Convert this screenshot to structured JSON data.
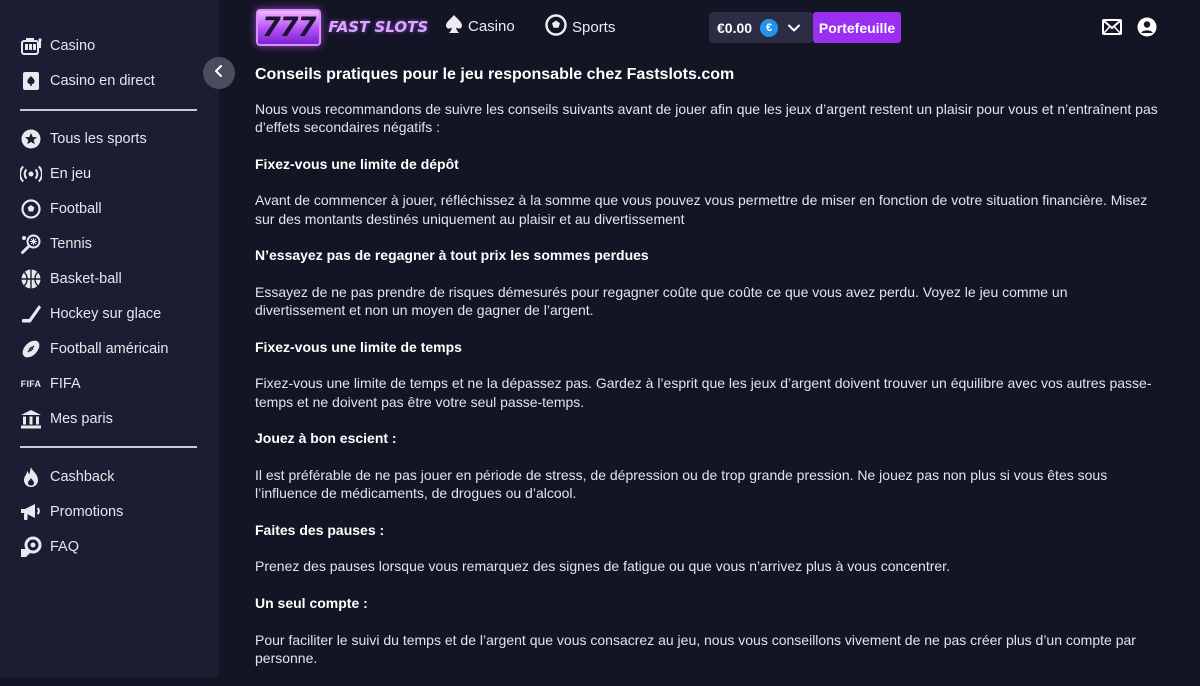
{
  "sidebar": {
    "groups": [
      {
        "items": [
          {
            "label": "Casino",
            "icon": "slot-machine-icon"
          },
          {
            "label": "Casino en direct",
            "icon": "playing-card-icon"
          }
        ]
      },
      {
        "items": [
          {
            "label": "Tous les sports",
            "icon": "star-icon"
          },
          {
            "label": "En jeu",
            "icon": "live-broadcast-icon"
          },
          {
            "label": "Football",
            "icon": "soccer-ball-icon"
          },
          {
            "label": "Tennis",
            "icon": "tennis-racket-icon"
          },
          {
            "label": "Basket-ball",
            "icon": "basketball-icon"
          },
          {
            "label": "Hockey sur glace",
            "icon": "hockey-stick-icon"
          },
          {
            "label": "Football américain",
            "icon": "american-football-icon"
          },
          {
            "label": "FIFA",
            "icon": "fifa-icon",
            "icon_text": "FIFA"
          },
          {
            "label": "Mes paris",
            "icon": "bet-slip-icon"
          }
        ]
      },
      {
        "items": [
          {
            "label": "Cashback",
            "icon": "flame-icon"
          },
          {
            "label": "Promotions",
            "icon": "megaphone-icon"
          },
          {
            "label": "FAQ",
            "icon": "lifebuoy-icon"
          }
        ]
      }
    ]
  },
  "header": {
    "logo_sevens": "777",
    "logo_text": "FAST SLOTS",
    "nav": [
      {
        "label": "Casino",
        "icon": "spade-icon"
      },
      {
        "label": "Sports",
        "icon": "soccer-ball-icon"
      }
    ],
    "balance": "€0.00",
    "currency_symbol": "€",
    "wallet_button": "Portefeuille",
    "icons": [
      "mail-icon",
      "user-icon"
    ]
  },
  "article": {
    "title": "Conseils pratiques pour le jeu responsable chez Fastslots.com",
    "blocks": [
      {
        "type": "p",
        "text": "Nous vous recommandons de suivre les conseils suivants avant de jouer afin que les jeux d’argent restent un plaisir pour vous et n’entraînent pas d’effets secondaires négatifs :"
      },
      {
        "type": "h",
        "text": "Fixez-vous une limite de dépôt"
      },
      {
        "type": "p",
        "text": "Avant de commencer à jouer, réfléchissez à la somme que vous pouvez vous permettre de miser en fonction de votre situation financière. Misez sur des montants destinés uniquement au plaisir et au divertissement"
      },
      {
        "type": "h",
        "text": "N’essayez pas de regagner à tout prix les sommes perdues"
      },
      {
        "type": "p",
        "text": "Essayez de ne pas prendre de risques démesurés pour regagner coûte que coûte ce que vous avez perdu. Voyez le jeu comme un divertissement et non un moyen de gagner de l’argent."
      },
      {
        "type": "h",
        "text": "Fixez-vous une limite de temps"
      },
      {
        "type": "p",
        "text": "Fixez-vous une limite de temps et ne la dépassez pas. Gardez à l’esprit que les jeux d’argent doivent trouver un équilibre avec vos autres passe-temps et ne doivent pas être votre seul passe-temps."
      },
      {
        "type": "h",
        "text": "Jouez à bon escient :"
      },
      {
        "type": "p",
        "text": "Il est préférable de ne pas jouer en période de stress, de dépression ou de trop grande pression. Ne jouez pas non plus si vous êtes sous l’influence de médicaments, de drogues ou d’alcool."
      },
      {
        "type": "h",
        "text": "Faites des pauses :"
      },
      {
        "type": "p",
        "text": "Prenez des pauses lorsque vous remarquez des signes de fatigue ou que vous n’arrivez plus à vous concentrer."
      },
      {
        "type": "h",
        "text": "Un seul compte :"
      },
      {
        "type": "p",
        "text": "Pour faciliter le suivi du temps et de l’argent que vous consacrez au jeu, nous vous conseillons vivement de ne pas créer plus d’un compte par personne."
      }
    ]
  },
  "colors": {
    "sidebar_bg": "#1c1d33",
    "page_bg": "#131424",
    "accent": "#9b2ff0",
    "currency_badge": "#2493e8"
  }
}
